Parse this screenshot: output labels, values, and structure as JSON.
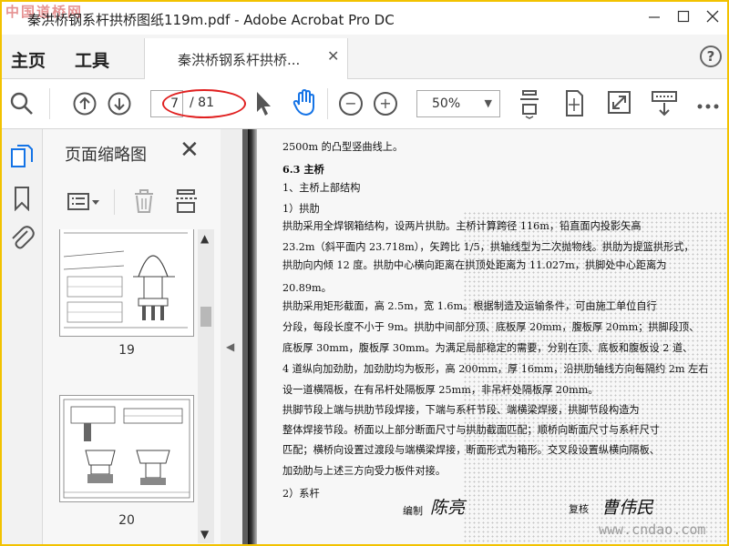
{
  "window": {
    "title": "秦洪桥钢系杆拱桥图纸119m.pdf - Adobe Acrobat Pro DC",
    "logo_watermark": "中国道桥网"
  },
  "tabs": {
    "home": "主页",
    "tools": "工具",
    "document": "秦洪桥钢系杆拱桥..."
  },
  "toolbar": {
    "current_page": "7",
    "total_pages": "/ 81",
    "zoom": "50%",
    "icons": [
      "search-icon",
      "page-up-icon",
      "page-down-icon",
      "select-pointer-icon",
      "hand-tool-icon",
      "zoom-out-icon",
      "zoom-in-icon",
      "fit-page-icon",
      "full-screen-icon",
      "read-mode-icon",
      "more-icon"
    ]
  },
  "thumbnail_panel": {
    "title": "页面缩略图",
    "pages": [
      {
        "number": "19"
      },
      {
        "number": "20"
      }
    ]
  },
  "document": {
    "lines": [
      {
        "text": "2500m 的凸型竖曲线上。",
        "heading": false
      },
      {
        "text": "6.3  主桥",
        "heading": true
      },
      {
        "text": "    1、主桥上部结构",
        "heading": false
      },
      {
        "text": "    1）拱肋",
        "heading": false
      },
      {
        "text": "    拱肋采用全焊钢箱结构，设两片拱肋。主桥计算跨径 116m，铅直面内投影矢高",
        "heading": false
      },
      {
        "text": "23.2m（斜平面内 23.718m），矢跨比 1/5，拱轴线型为二次抛物线。拱肋为提篮拱形式，",
        "heading": false
      },
      {
        "text": "拱肋向内倾 12 度。拱肋中心横向距离在拱顶处距离为 11.027m，拱脚处中心距离为",
        "heading": false
      },
      {
        "text": "20.89m。",
        "heading": false
      },
      {
        "text": "    拱肋采用矩形截面，高 2.5m，宽 1.6m。根据制造及运输条件，可由施工单位自行",
        "heading": false
      },
      {
        "text": "分段，每段长度不小于 9m。拱肋中间部分顶、底板厚 20mm，腹板厚 20mm；拱脚段顶、",
        "heading": false
      },
      {
        "text": "底板厚 30mm，腹板厚 30mm。为满足局部稳定的需要，分别在顶、底板和腹板设 2 道、",
        "heading": false
      },
      {
        "text": "4 道纵向加劲肋，加劲肋均为板形，高 200mm，厚 16mm，沿拱肋轴线方向每隔约 2m 左右",
        "heading": false
      },
      {
        "text": "设一道横隔板，在有吊杆处隔板厚 25mm，非吊杆处隔板厚 20mm。",
        "heading": false
      },
      {
        "text": "    拱脚节段上端与拱肋节段焊接，下端与系杆节段、端横梁焊接，拱脚节段构造为",
        "heading": false
      },
      {
        "text": "整体焊接节段。桥面以上部分断面尺寸与拱肋截面匹配；顺桥向断面尺寸与系杆尺寸",
        "heading": false
      },
      {
        "text": "匹配；横桥向设置过渡段与端横梁焊接，断面形式为箱形。交叉段设置纵横向隔板、",
        "heading": false
      },
      {
        "text": "加劲肋与上述三方向受力板件对接。",
        "heading": false
      },
      {
        "text": "    2）系杆",
        "heading": false
      }
    ],
    "footer_left_label": "编制",
    "footer_right_label": "复核",
    "signature_left": "陈亮",
    "signature_right": "曹伟民"
  },
  "watermark": "www.cndao.com",
  "colors": {
    "accent_blue": "#1473e6",
    "annotation_red": "#e02020",
    "frame_yellow": "#f2c200"
  }
}
